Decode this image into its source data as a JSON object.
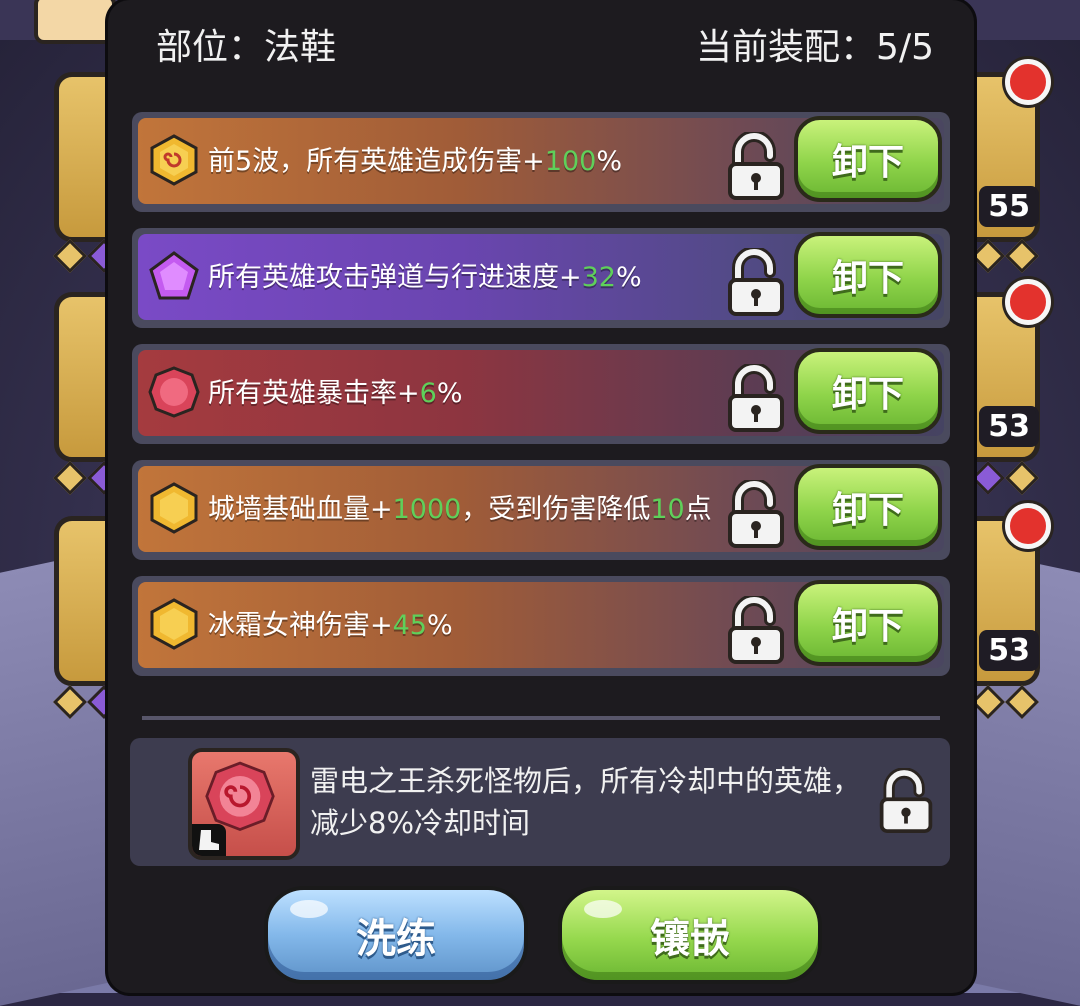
{
  "header": {
    "slot_label": "部位：法鞋",
    "equipped_label": "当前装配：5/5"
  },
  "background": {
    "slot_levels": [
      "55",
      "53",
      "53"
    ]
  },
  "gems": [
    {
      "gem_type": "gold-swirl",
      "prefix": "前5波，所有英雄造成伤害+",
      "value": "100",
      "suffix": "%",
      "extra_value": "",
      "extra_suffix": "",
      "button": "卸下"
    },
    {
      "gem_type": "purple-pentagon",
      "prefix": "所有英雄攻击弹道与行进速度+",
      "value": "32",
      "suffix": "%",
      "extra_value": "",
      "extra_suffix": "",
      "button": "卸下"
    },
    {
      "gem_type": "red-round",
      "prefix": "所有英雄暴击率+",
      "value": "6",
      "suffix": "%",
      "extra_value": "",
      "extra_suffix": "",
      "button": "卸下"
    },
    {
      "gem_type": "gold-hexagon",
      "prefix": "城墙基础血量+",
      "value": "1000",
      "suffix": "，受到伤害降低",
      "extra_value": "10",
      "extra_suffix": "点",
      "button": "卸下"
    },
    {
      "gem_type": "gold-hexagon",
      "prefix": "冰霜女神伤害+",
      "value": "45",
      "suffix": "%",
      "extra_value": "",
      "extra_suffix": "",
      "button": "卸下"
    }
  ],
  "detail": {
    "description": "雷电之王杀死怪物后，所有冷却中的英雄，减少8%冷却时间"
  },
  "buttons": {
    "refine": "洗练",
    "inlay": "镶嵌"
  },
  "colors": {
    "highlight": "#5fd05a",
    "panel": "#1d1b1f",
    "green_button": "#8fd44a",
    "blue_button": "#83b8ea"
  }
}
